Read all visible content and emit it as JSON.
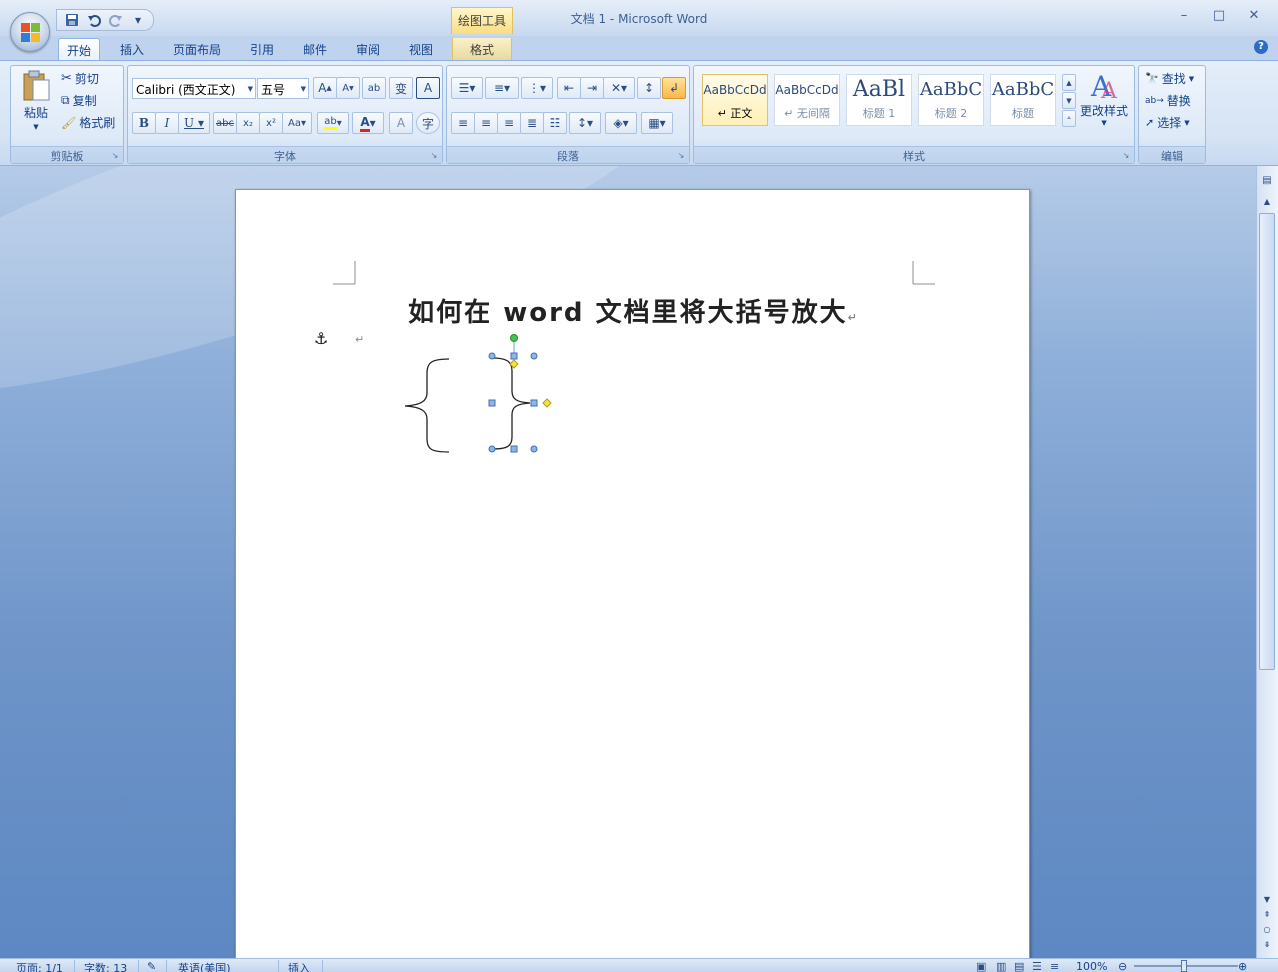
{
  "window": {
    "title": "文档 1 - Microsoft Word",
    "contextual_tool": "绘图工具",
    "minimize": "–",
    "maximize": "□",
    "close": "✕"
  },
  "quick_access": {
    "save_icon": "save-icon",
    "undo_icon": "undo-icon",
    "redo_icon": "redo-icon",
    "customize": "▾"
  },
  "tabs": [
    "开始",
    "插入",
    "页面布局",
    "引用",
    "邮件",
    "审阅",
    "视图",
    "格式"
  ],
  "ribbon": {
    "clipboard": {
      "label": "剪贴板",
      "paste": "粘贴",
      "cut": "剪切",
      "copy": "复制",
      "format_painter": "格式刷"
    },
    "font": {
      "label": "字体",
      "font_name": "Calibri (西文正文)",
      "font_size": "五号"
    },
    "paragraph": {
      "label": "段落"
    },
    "styles": {
      "label": "样式",
      "tiles": [
        {
          "sample": "AaBbCcDd",
          "name": "↵ 正文"
        },
        {
          "sample": "AaBbCcDd",
          "name": "↵ 无间隔"
        },
        {
          "sample": "AaBl",
          "name": "标题 1"
        },
        {
          "sample": "AaBbC",
          "name": "标题 2"
        },
        {
          "sample": "AaBbC",
          "name": "标题"
        }
      ],
      "change_styles": "更改样式"
    },
    "editing": {
      "label": "编辑",
      "find": "查找",
      "replace": "替换",
      "select": "选择"
    }
  },
  "document": {
    "title_text": "如何在 word 文档里将大括号放大",
    "para_mark": "↵"
  },
  "statusbar": {
    "page": "页面: 1/1",
    "words": "字数: 13",
    "language": "英语(美国)",
    "mode": "插入",
    "zoom": "100%"
  }
}
